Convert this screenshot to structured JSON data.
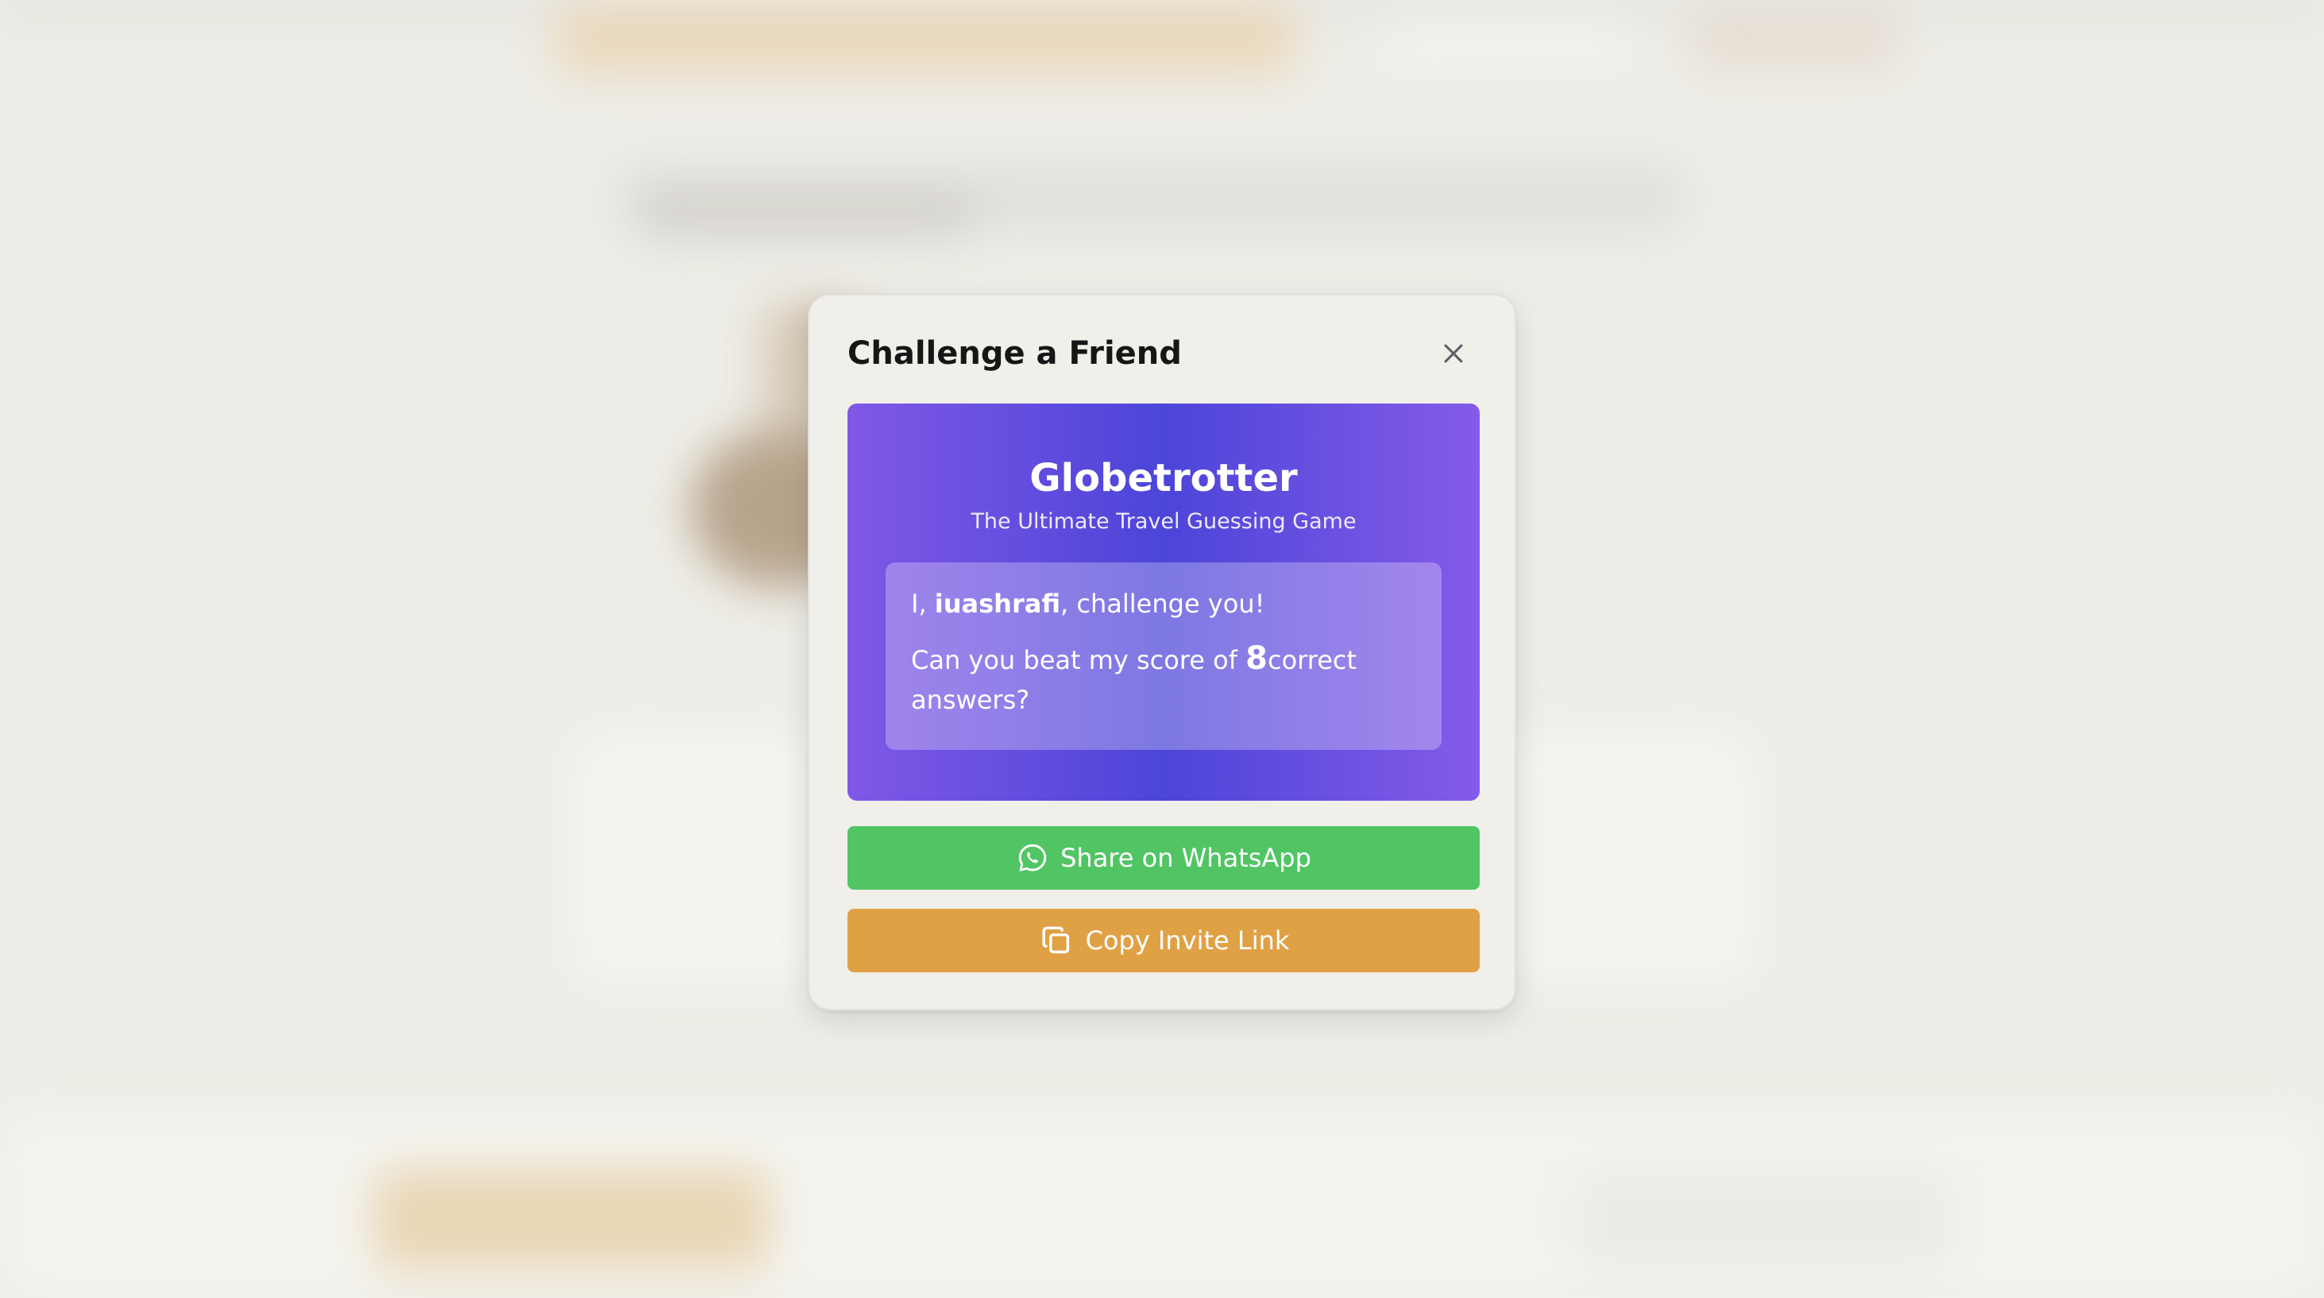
{
  "modal": {
    "title": "Challenge a Friend"
  },
  "hero": {
    "title": "Globetrotter",
    "subtitle": "The Ultimate Travel Guessing Game",
    "gradient_colors": [
      "#8058e6",
      "#4c45d8",
      "#855be8"
    ]
  },
  "challenge": {
    "prefix": "I, ",
    "username": "iuashrafi",
    "suffix": ", challenge you!",
    "score_prefix": "Can you beat my score of ",
    "score": "8",
    "score_suffix": "correct answers?"
  },
  "buttons": {
    "whatsapp_label": "Share on WhatsApp",
    "whatsapp_icon": "whatsapp-icon",
    "whatsapp_color": "#51c564",
    "copy_label": "Copy Invite Link",
    "copy_icon": "copy-icon",
    "copy_color": "#e0a145"
  },
  "icons": {
    "close": "close-icon"
  }
}
